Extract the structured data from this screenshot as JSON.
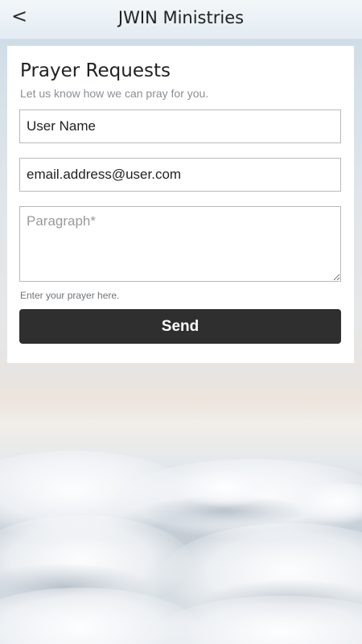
{
  "header": {
    "title": "JWIN Ministries",
    "back_glyph": "<",
    "back_icon": "back-chevron-icon"
  },
  "form": {
    "title": "Prayer Requests",
    "subtitle": "Let us know how we can pray for you.",
    "name_value": "User Name",
    "email_value": "email.address@user.com",
    "paragraph_placeholder": "Paragraph*",
    "hint": "Enter your prayer here.",
    "send_label": "Send"
  },
  "colors": {
    "button_bg": "#2f2f2f",
    "card_bg": "#ffffff",
    "field_border": "#b9b9b9"
  }
}
